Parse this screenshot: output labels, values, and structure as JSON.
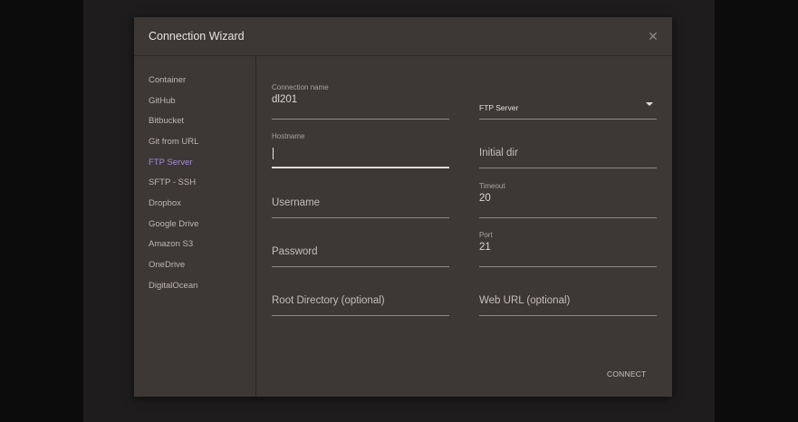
{
  "dialog": {
    "title": "Connection Wizard",
    "close_icon": "close-icon",
    "connect_label": "CONNECT"
  },
  "sidebar": {
    "items": [
      {
        "label": "Container"
      },
      {
        "label": "GitHub"
      },
      {
        "label": "Bitbucket"
      },
      {
        "label": "Git from URL"
      },
      {
        "label": "FTP Server",
        "active": true
      },
      {
        "label": "SFTP - SSH"
      },
      {
        "label": "Dropbox"
      },
      {
        "label": "Google Drive"
      },
      {
        "label": "Amazon S3"
      },
      {
        "label": "OneDrive"
      },
      {
        "label": "DigitalOcean"
      }
    ],
    "active_color": "#a48bd6"
  },
  "form": {
    "connection_name": {
      "label": "Connection name",
      "value": "dl201"
    },
    "server_type": {
      "value": "FTP Server",
      "options": [
        "FTP Server"
      ]
    },
    "hostname": {
      "label": "Hostname",
      "value": ""
    },
    "initial_dir": {
      "placeholder": "Initial dir"
    },
    "username": {
      "placeholder": "Username"
    },
    "timeout": {
      "label": "Timeout",
      "value": "20"
    },
    "password": {
      "placeholder": "Password"
    },
    "port": {
      "label": "Port",
      "value": "21"
    },
    "root_directory": {
      "placeholder": "Root Directory (optional)"
    },
    "web_url": {
      "placeholder": "Web URL (optional)"
    }
  }
}
